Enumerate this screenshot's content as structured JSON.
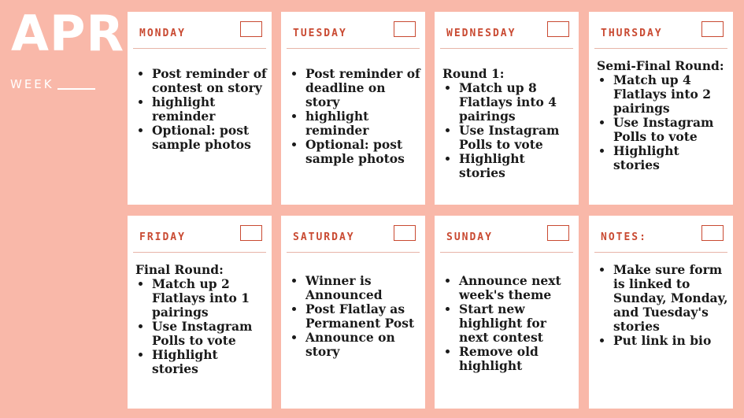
{
  "header": {
    "month": "APR",
    "week_label": "WEEK"
  },
  "cards": [
    {
      "day": "MONDAY",
      "intro": "",
      "items": [
        "Post reminder of contest on story",
        "highlight reminder",
        "Optional: post sample photos"
      ]
    },
    {
      "day": "TUESDAY",
      "intro": "",
      "items": [
        "Post reminder of deadline on story",
        "highlight reminder",
        "Optional: post sample photos"
      ]
    },
    {
      "day": "WEDNESDAY",
      "intro": "Round 1:",
      "items": [
        "Match up 8 Flatlays into 4 pairings",
        "Use Instagram Polls to vote",
        "Highlight stories"
      ]
    },
    {
      "day": "THURSDAY",
      "intro": "Semi-Final Round:",
      "items": [
        "Match up 4 Flatlays into 2 pairings",
        "Use Instagram Polls to vote",
        "Highlight stories"
      ]
    },
    {
      "day": "FRIDAY",
      "intro": "Final Round:",
      "items": [
        "Match up 2 Flatlays into 1 pairings",
        "Use Instagram Polls to vote",
        "Highlight stories"
      ]
    },
    {
      "day": "SATURDAY",
      "intro": "",
      "items": [
        "Winner is Announced",
        "Post Flatlay as Permanent Post",
        "Announce on story"
      ]
    },
    {
      "day": "SUNDAY",
      "intro": "",
      "items": [
        "Announce next week's theme",
        "Start new highlight for next contest",
        "Remove old highlight"
      ]
    },
    {
      "day": "NOTES:",
      "intro": "",
      "items": [
        "Make sure form is linked to Sunday, Monday, and Tuesday's stories",
        "Put link in bio"
      ]
    }
  ]
}
